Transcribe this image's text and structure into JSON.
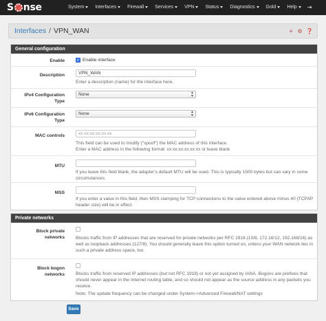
{
  "navbar": {
    "brand_left": "S",
    "brand_right": "nse",
    "items": [
      "System",
      "Interfaces",
      "Firewall",
      "Services",
      "VPN",
      "Status",
      "Diagnostics",
      "Gold",
      "Help"
    ],
    "logout_icon": "logout-icon"
  },
  "breadcrumb": {
    "parent": "Interfaces",
    "separator": "/",
    "current": "VPN_WAN",
    "icons": [
      "sliders-icon",
      "gear-icon",
      "help-icon"
    ]
  },
  "general": {
    "heading": "General configuration",
    "enable": {
      "label": "Enable",
      "checkbox_label": "Enable interface",
      "checked": true
    },
    "description": {
      "label": "Description",
      "value": "VPN_WAN",
      "help": "Enter a description (name) for the interface here."
    },
    "ipv4": {
      "label_line1": "IPv4 Configuration",
      "label_line2": "Type",
      "value": "None"
    },
    "ipv6": {
      "label_line1": "IPv6 Configuration",
      "label_line2": "Type",
      "value": "None"
    },
    "mac": {
      "label": "MAC controls",
      "placeholder": "xx:xx:xx:xx:xx:xx",
      "help_line1": "This field can be used to modify (\"spoof\") the MAC address of this interface.",
      "help_line2": "Enter a MAC address in the following format: xx:xx:xx:xx:xx:xx or leave blank"
    },
    "mtu": {
      "label": "MTU",
      "value": "",
      "help_line1": "If you leave this field blank, the adapter's default MTU will be used. This is typically 1500 bytes but can vary in some",
      "help_line2": "circumstances."
    },
    "mss": {
      "label": "MSS",
      "value": "",
      "help_line1": "If you enter a value in this field, then MSS clamping for TCP connections to the value entered above minus 40 (TCP/IP",
      "help_line2": "header size) will be in effect."
    }
  },
  "private": {
    "heading": "Private networks",
    "block_private": {
      "label_line1": "Block private",
      "label_line2": "networks",
      "checked": false,
      "help_line1": "Blocks traffic from IP addresses that are reserved for private networks per RFC 1918 (10/8, 172.16/12, 192.168/16) as",
      "help_line2": "well as loopback addresses (127/8). You should generally leave this option turned on, unless your WAN network lies in",
      "help_line3": "such a private address space, too."
    },
    "block_bogon": {
      "label_line1": "Block bogon",
      "label_line2": "networks",
      "checked": false,
      "help_line1": "Blocks traffic from reserved IP addresses (but not RFC 1918) or not yet assigned by IANA. Bogons are prefixes that",
      "help_line2": "should never appear in the Internet routing table, and so should not appear as the source address in any packets you",
      "help_line3": "receive.",
      "help_line4": "Note: The update frequency can be changed under System->Advanced Firewall/NAT settings"
    }
  },
  "save_label": "Save",
  "colors": {
    "navbar": "#212121",
    "panel_heading": "#424242",
    "brand_accent": "#d9534f",
    "save_button": "#337ab7",
    "checkbox_checked": "#3b7be8"
  }
}
